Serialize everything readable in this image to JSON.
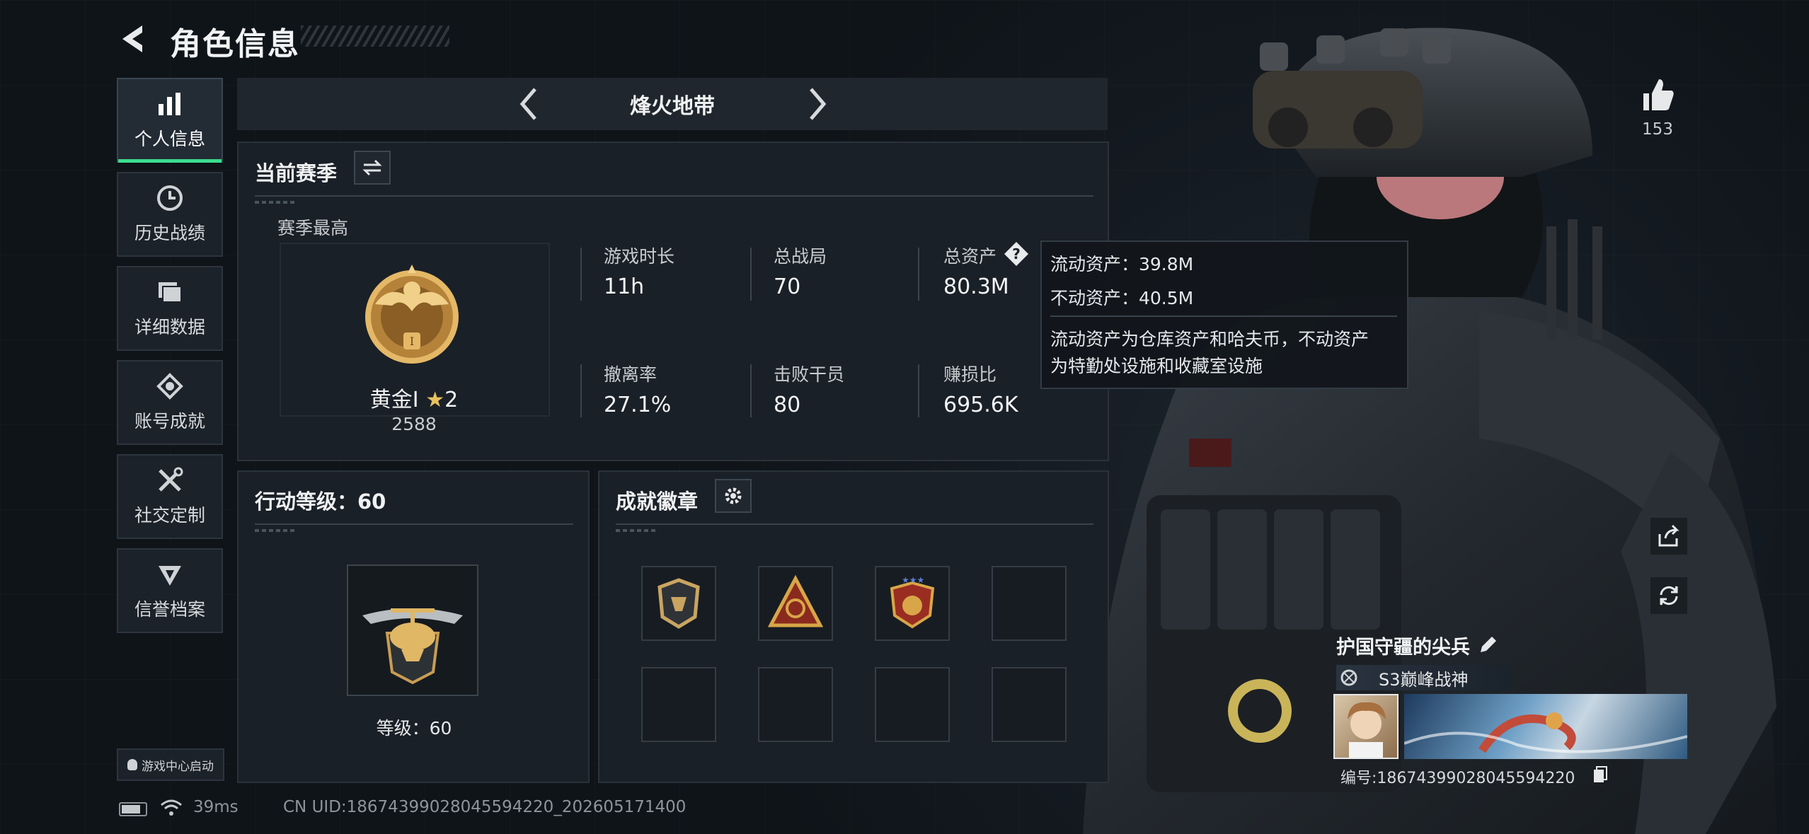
{
  "header": {
    "title": "角色信息"
  },
  "sidebar": {
    "items": [
      {
        "label": "个人信息",
        "icon": "bar-chart-icon",
        "active": true
      },
      {
        "label": "历史战绩",
        "icon": "clock-icon"
      },
      {
        "label": "详细数据",
        "icon": "folder-icon"
      },
      {
        "label": "账号成就",
        "icon": "achievement-icon"
      },
      {
        "label": "社交定制",
        "icon": "tools-icon"
      },
      {
        "label": "信誉档案",
        "icon": "credibility-icon"
      }
    ],
    "game_center": "游戏中心启动"
  },
  "mode_selector": {
    "label": "烽火地带"
  },
  "season": {
    "header": "当前赛季",
    "best_label": "赛季最高",
    "rank_name": "黄金I",
    "rank_stars": "2",
    "rank_score": "2588",
    "rank_badge_numeral": "I",
    "stats": [
      {
        "label": "游戏时长",
        "value": "11h"
      },
      {
        "label": "总战局",
        "value": "70"
      },
      {
        "label": "总资产",
        "value": "80.3M",
        "has_help": true
      },
      {
        "label": "撤离率",
        "value": "27.1%"
      },
      {
        "label": "击败干员",
        "value": "80"
      },
      {
        "label": "赚损比",
        "value": "695.6K"
      }
    ]
  },
  "tooltip": {
    "liquid": "流动资产：39.8M",
    "fixed": "不动资产：40.5M",
    "desc_line1": "流动资产为仓库资产和哈夫币，不动资产",
    "desc_line2": "为特勤处设施和收藏室设施"
  },
  "action_level": {
    "header": "行动等级：60",
    "level_text": "等级：60"
  },
  "badges": {
    "header": "成就徽章",
    "filled": 3,
    "total": 8
  },
  "right": {
    "like_count": "153",
    "player_name": "护国守疆的尖兵",
    "title": "S3巅峰战神",
    "player_id": "编号:18674399028045594220"
  },
  "status_bar": {
    "ping": "39ms",
    "uid": "CN UID:18674399028045594220_202605171400"
  },
  "colors": {
    "accent": "#3bdc8e",
    "gold": "#d4a04a",
    "panel": "#1a2027"
  }
}
